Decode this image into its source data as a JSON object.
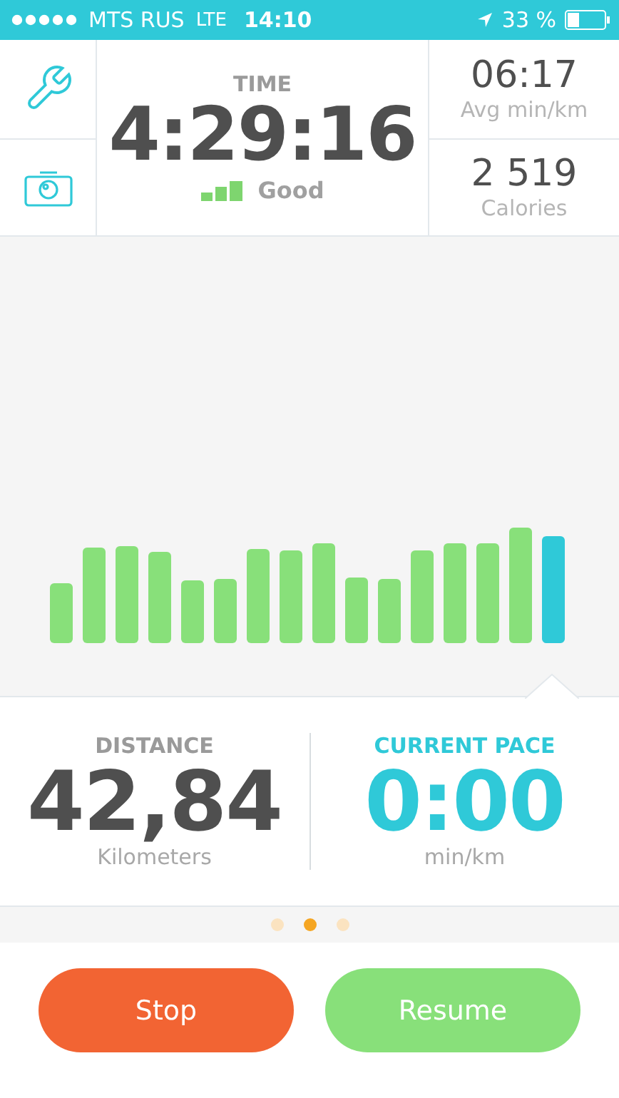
{
  "status_bar": {
    "carrier": "MTS RUS",
    "network": "LTE",
    "time": "14:10",
    "battery": "33 %"
  },
  "time": {
    "label": "TIME",
    "value": "4:29:16",
    "signal": "Good"
  },
  "stats": [
    {
      "value": "06:17",
      "label": "Avg min/km"
    },
    {
      "value": "2 519",
      "label": "Calories"
    }
  ],
  "distance": {
    "label": "DISTANCE",
    "value": "42,84",
    "unit": "Kilometers"
  },
  "current_pace": {
    "label": "CURRENT PACE",
    "value": "0:00",
    "unit": "min/km"
  },
  "pages": [
    {
      "selected": false
    },
    {
      "selected": true
    },
    {
      "selected": false
    }
  ],
  "buttons": [
    {
      "label": "Stop",
      "kind": "stop"
    },
    {
      "label": "Resume",
      "kind": "resume"
    }
  ]
}
